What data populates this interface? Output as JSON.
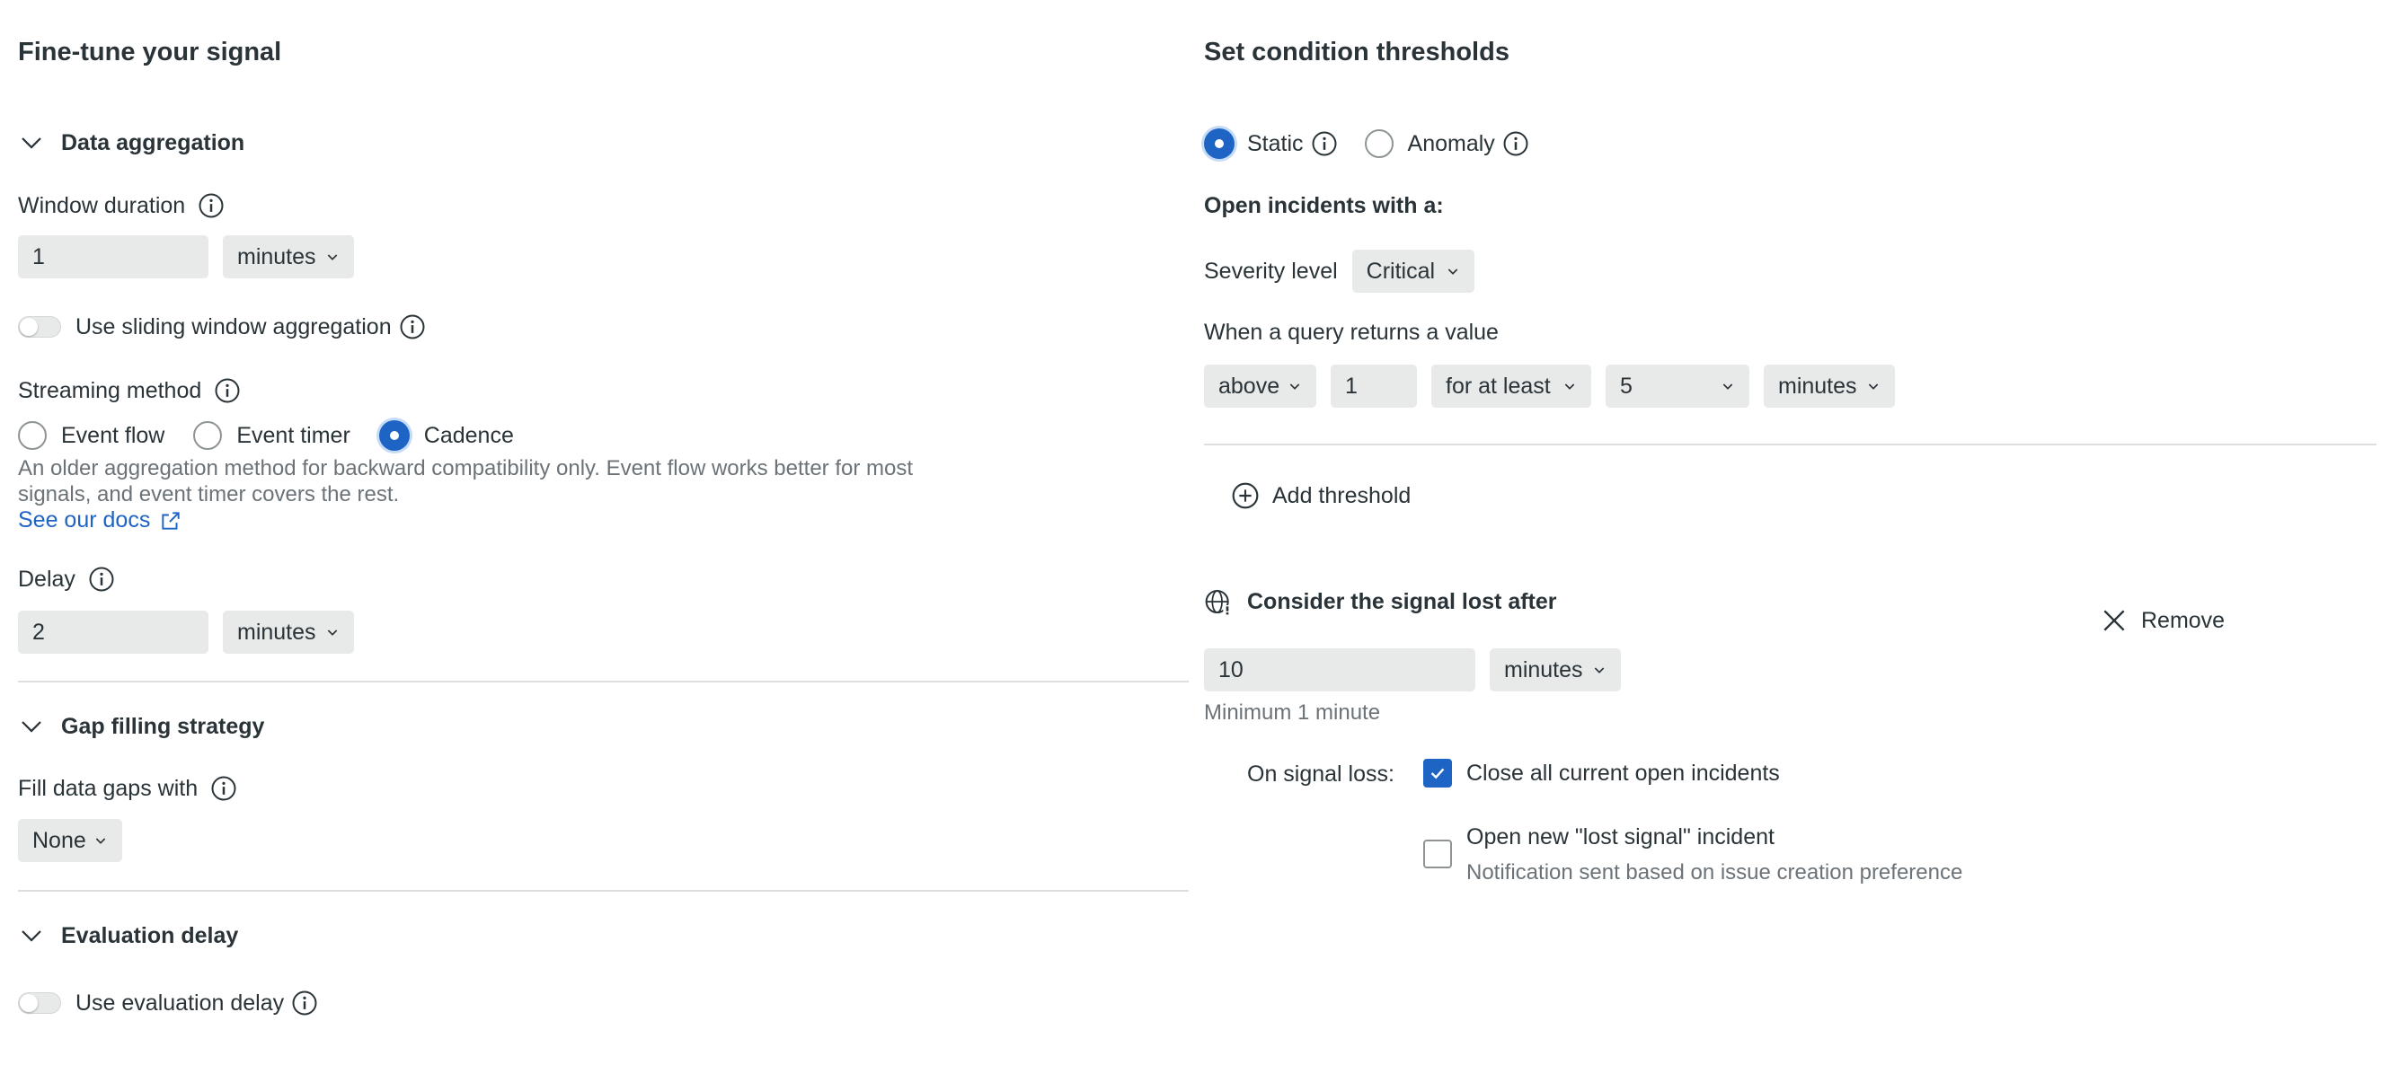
{
  "left": {
    "title": "Fine-tune your signal",
    "data_aggregation": {
      "header": "Data aggregation",
      "window_duration_label": "Window duration",
      "window_duration_value": "1",
      "window_duration_unit": "minutes",
      "sliding_label": "Use sliding window aggregation",
      "streaming_label": "Streaming method",
      "streaming_options": [
        "Event flow",
        "Event timer",
        "Cadence"
      ],
      "streaming_selected": "Cadence",
      "description_line1": "An older aggregation method for backward compatibility only. Event flow works better for most",
      "description_line2": "signals, and event timer covers the rest.",
      "docs_link": "See our docs",
      "delay_label": "Delay",
      "delay_value": "2",
      "delay_unit": "minutes"
    },
    "gap_filling": {
      "header": "Gap filling strategy",
      "fill_label": "Fill data gaps with",
      "fill_value": "None"
    },
    "evaluation_delay": {
      "header": "Evaluation delay",
      "toggle_label": "Use evaluation delay"
    }
  },
  "right": {
    "title": "Set condition thresholds",
    "threshold_types": [
      "Static",
      "Anomaly"
    ],
    "threshold_selected": "Static",
    "open_incidents_label": "Open incidents with a:",
    "severity_label": "Severity level",
    "severity_value": "Critical",
    "query_label": "When a query returns a value",
    "operator": "above",
    "threshold_value": "1",
    "occurrence": "for at least",
    "duration_value": "5",
    "duration_unit": "minutes",
    "add_threshold": "Add threshold",
    "signal_lost_label": "Consider the signal lost after",
    "remove_label": "Remove",
    "lost_value": "10",
    "lost_unit": "minutes",
    "minimum_hint": "Minimum 1 minute",
    "on_signal_loss_label": "On signal loss:",
    "close_incidents_label": "Close all current open incidents",
    "close_incidents_checked": true,
    "open_lost_label": "Open new \"lost signal\" incident",
    "open_lost_checked": false,
    "open_lost_hint": "Notification sent based on issue creation preference"
  },
  "colors": {
    "accent": "#1d64c4",
    "text": "#293338",
    "muted": "#6b7378",
    "field_bg": "#e8e9e9"
  }
}
